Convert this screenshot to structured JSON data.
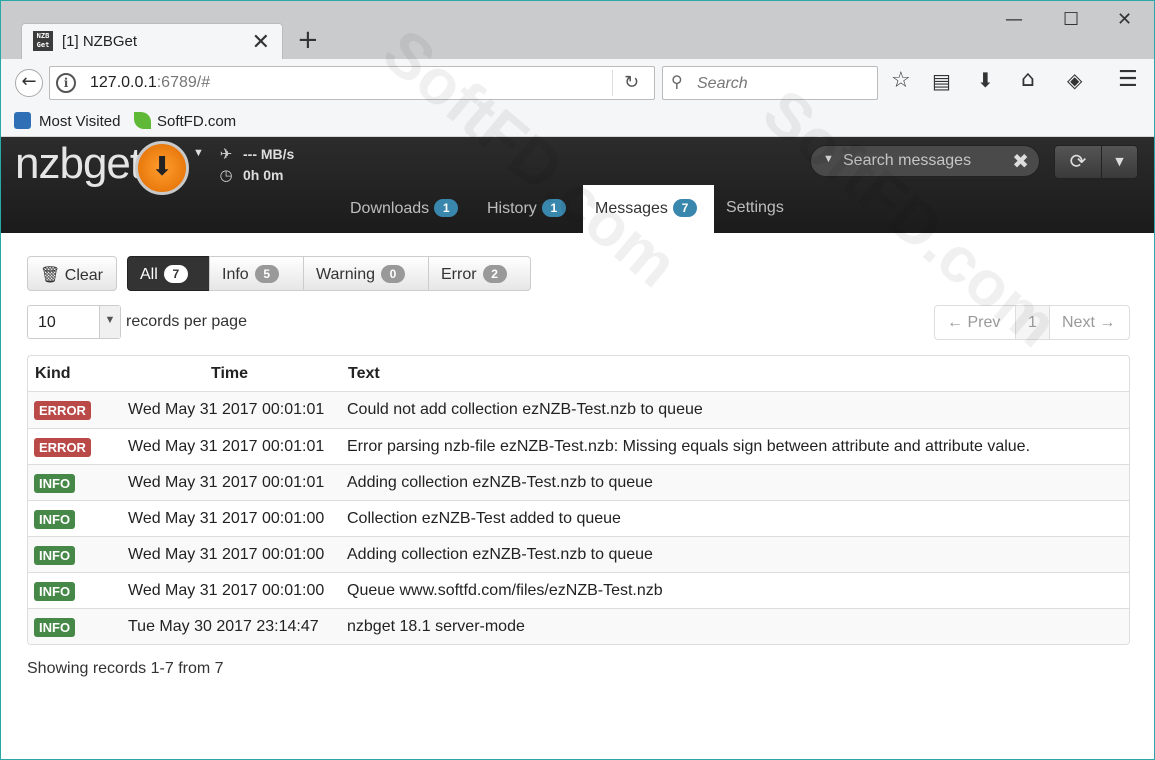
{
  "browser": {
    "tab_title": "[1] NZBGet",
    "favicon_text": "NZB Get",
    "url_host": "127.0.0.1",
    "url_rest": ":6789/#",
    "search_placeholder": "Search",
    "bookmarks": [
      {
        "label": "Most Visited",
        "icon": "globe-icon",
        "color": "#2f6fb5"
      },
      {
        "label": "SoftFD.com",
        "icon": "leaf-icon",
        "color": "#5fb836"
      }
    ]
  },
  "app": {
    "logo": "nzbget",
    "speed": "--- MB/s",
    "time_left": "0h 0m",
    "search_placeholder": "Search messages",
    "nav": [
      {
        "label": "Downloads",
        "badge": "1"
      },
      {
        "label": "History",
        "badge": "1"
      },
      {
        "label": "Messages",
        "badge": "7",
        "active": true
      },
      {
        "label": "Settings"
      }
    ],
    "accent_color": "#f28a17",
    "badge_color": "#3a87ad"
  },
  "toolbar": {
    "clear_label": "Clear",
    "filters": [
      {
        "label": "All",
        "count": "7",
        "active": true
      },
      {
        "label": "Info",
        "count": "5"
      },
      {
        "label": "Warning",
        "count": "0"
      },
      {
        "label": "Error",
        "count": "2"
      }
    ],
    "records_per_page": "10",
    "records_label": "records per page",
    "pager": {
      "prev": "← Prev",
      "page": "1",
      "next": "Next →"
    }
  },
  "table": {
    "headers": {
      "kind": "Kind",
      "time": "Time",
      "text": "Text"
    },
    "rows": [
      {
        "kind": "ERROR",
        "time": "Wed May 31 2017 00:01:01",
        "text": "Could not add collection ezNZB-Test.nzb to queue"
      },
      {
        "kind": "ERROR",
        "time": "Wed May 31 2017 00:01:01",
        "text": "Error parsing nzb-file ezNZB-Test.nzb: Missing equals sign between attribute and attribute value."
      },
      {
        "kind": "INFO",
        "time": "Wed May 31 2017 00:01:01",
        "text": "Adding collection ezNZB-Test.nzb to queue"
      },
      {
        "kind": "INFO",
        "time": "Wed May 31 2017 00:01:00",
        "text": "Collection ezNZB-Test added to queue"
      },
      {
        "kind": "INFO",
        "time": "Wed May 31 2017 00:01:00",
        "text": "Adding collection ezNZB-Test.nzb to queue"
      },
      {
        "kind": "INFO",
        "time": "Wed May 31 2017 00:01:00",
        "text": "Queue www.softfd.com/files/ezNZB-Test.nzb"
      },
      {
        "kind": "INFO",
        "time": "Tue May 30 2017 23:14:47",
        "text": "nzbget 18.1 server-mode"
      }
    ],
    "kind_colors": {
      "ERROR": "#b94a48",
      "INFO": "#468847"
    }
  },
  "footer": "Showing records 1-7 from 7",
  "watermark": "SoftFD.com"
}
